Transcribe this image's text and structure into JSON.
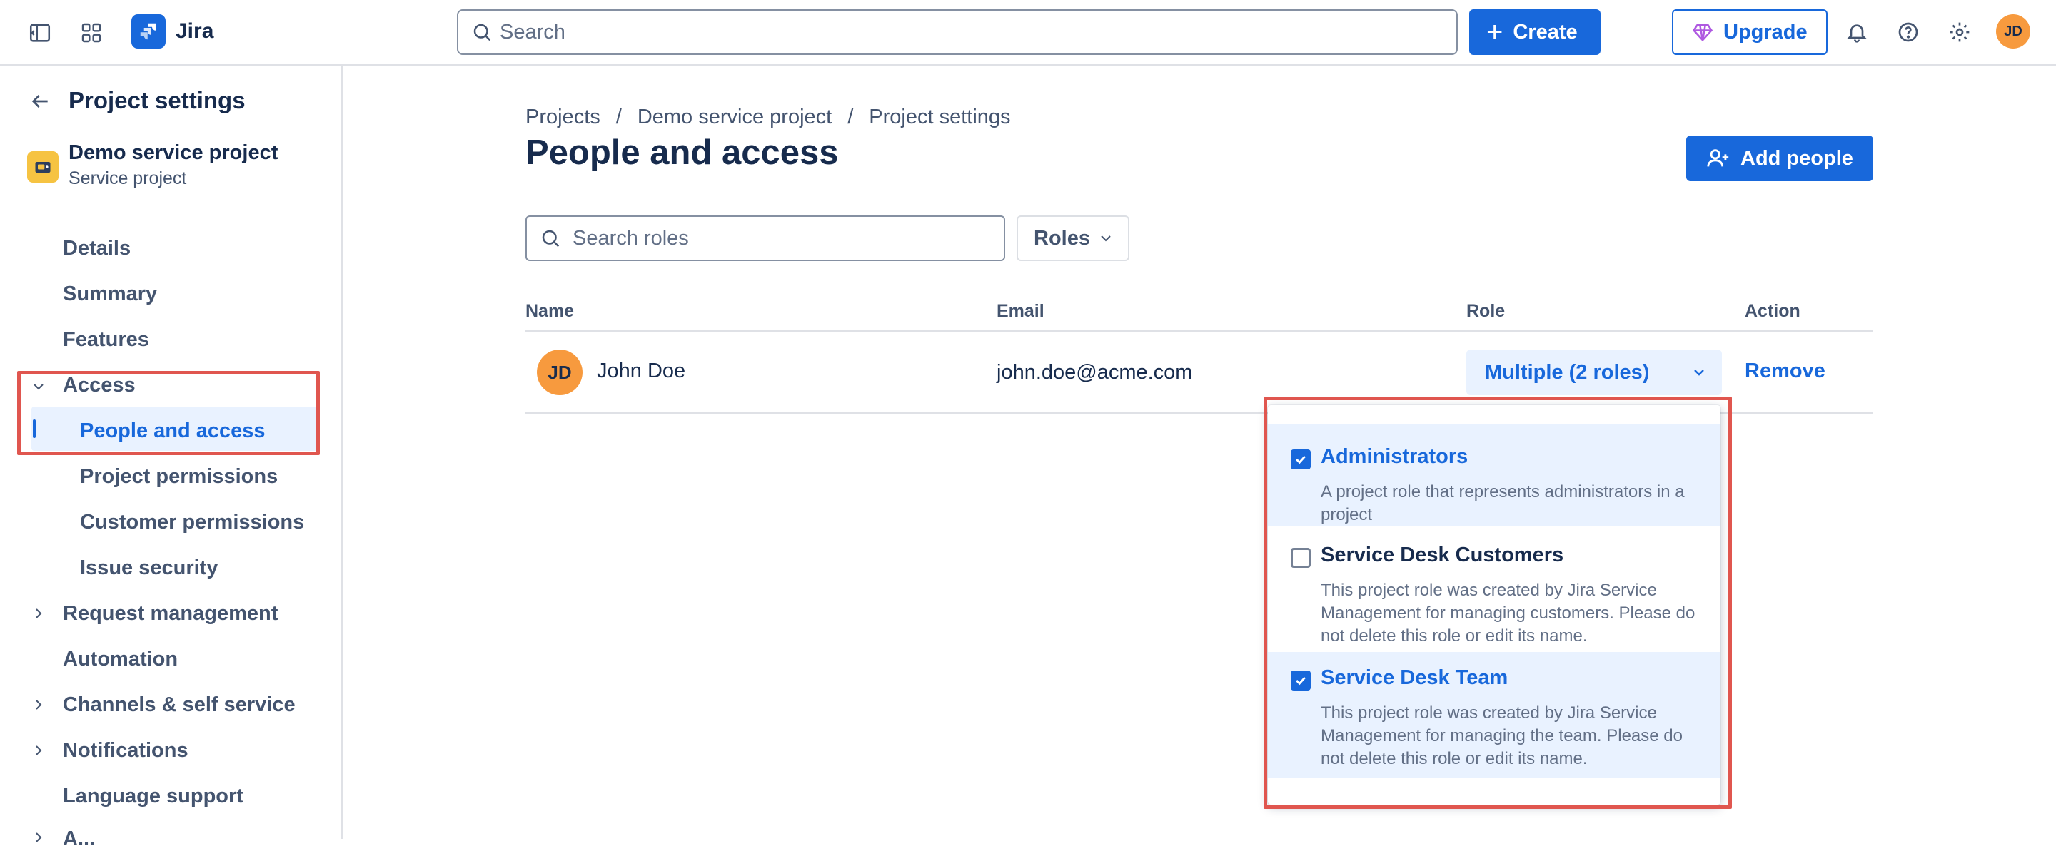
{
  "app": {
    "name": "Jira"
  },
  "topbar": {
    "search_placeholder": "Search",
    "create_label": "Create",
    "upgrade_label": "Upgrade",
    "user_initials": "JD"
  },
  "sidebar": {
    "title": "Project settings",
    "project_name": "Demo service project",
    "project_type": "Service project",
    "items": [
      {
        "label": "Details"
      },
      {
        "label": "Summary"
      },
      {
        "label": "Features"
      },
      {
        "label": "Access"
      },
      {
        "label": "People and access"
      },
      {
        "label": "Project permissions"
      },
      {
        "label": "Customer permissions"
      },
      {
        "label": "Issue security"
      },
      {
        "label": "Request management"
      },
      {
        "label": "Automation"
      },
      {
        "label": "Channels & self service"
      },
      {
        "label": "Notifications"
      },
      {
        "label": "Language support"
      },
      {
        "label": "A..."
      }
    ]
  },
  "breadcrumbs": [
    "Projects",
    "Demo service project",
    "Project settings"
  ],
  "page": {
    "title": "People and access",
    "add_people_label": "Add people",
    "search_roles_placeholder": "Search roles",
    "roles_filter_label": "Roles"
  },
  "table": {
    "headers": [
      "Name",
      "Email",
      "Role",
      "Action"
    ],
    "rows": [
      {
        "initials": "JD",
        "name": "John Doe",
        "email": "john.doe@acme.com",
        "role": "Multiple (2 roles)",
        "action": "Remove"
      }
    ]
  },
  "role_dropdown": {
    "options": [
      {
        "title": "Administrators",
        "description": "A project role that represents administrators in a project",
        "checked": true
      },
      {
        "title": "Service Desk Customers",
        "description": "This project role was created by Jira Service Management for managing customers. Please do not delete this role or edit its name.",
        "checked": false
      },
      {
        "title": "Service Desk Team",
        "description": "This project role was created by Jira Service Management for managing the team. Please do not delete this role or edit its name.",
        "checked": true
      }
    ]
  },
  "colors": {
    "brand": "#1868db",
    "highlight_box": "#e0564f",
    "selected_bg": "#e9f2ff",
    "avatar": "#f79a3e"
  }
}
